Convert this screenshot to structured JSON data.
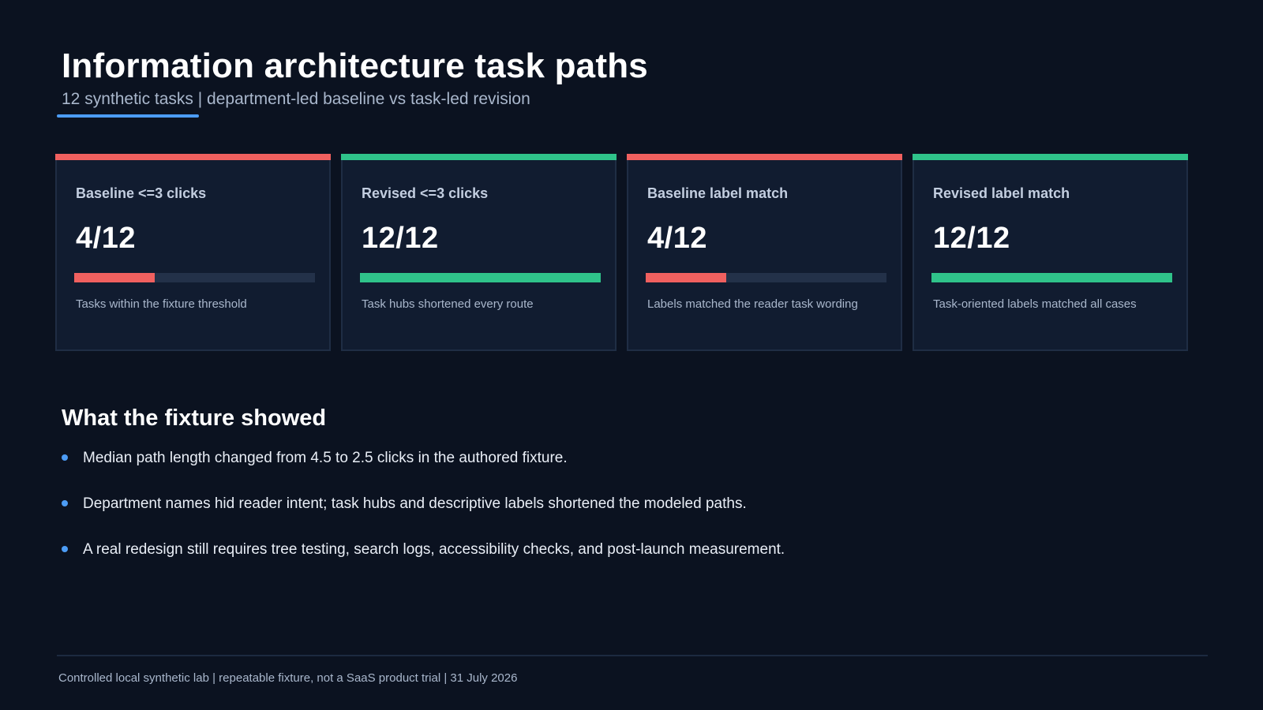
{
  "header": {
    "title": "Information architecture task paths",
    "subtitle": "12 synthetic tasks | department-led baseline vs task-led revision"
  },
  "colors": {
    "background": "#0b1220",
    "card": "#111c30",
    "accent_blue": "#4c9cf5",
    "bad_red": "#f0605f",
    "good_green": "#2fc38a",
    "track": "#233149"
  },
  "cards": [
    {
      "label": "Baseline <=3 clicks",
      "value": "4/12",
      "progress": 0.3333,
      "status_color": "#f0605f",
      "note": "Tasks within the fixture threshold"
    },
    {
      "label": "Revised <=3 clicks",
      "value": "12/12",
      "progress": 1.0,
      "status_color": "#2fc38a",
      "note": "Task hubs shortened every route"
    },
    {
      "label": "Baseline label match",
      "value": "4/12",
      "progress": 0.3333,
      "status_color": "#f0605f",
      "note": "Labels matched the reader task wording"
    },
    {
      "label": "Revised label match",
      "value": "12/12",
      "progress": 1.0,
      "status_color": "#2fc38a",
      "note": "Task-oriented labels matched all cases"
    }
  ],
  "findings": {
    "title": "What the fixture showed",
    "bullets": [
      "Median path length changed from 4.5 to 2.5 clicks in the authored fixture.",
      "Department names hid reader intent; task hubs and descriptive labels shortened the modeled paths.",
      "A real redesign still requires tree testing, search logs, accessibility checks, and post-launch measurement."
    ]
  },
  "footer": {
    "text": "Controlled local synthetic lab | repeatable fixture, not a SaaS product trial | 31 July 2026"
  }
}
